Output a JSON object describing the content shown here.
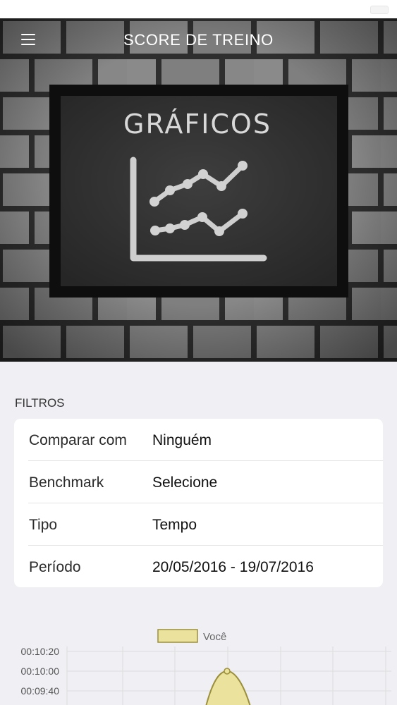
{
  "app_bar": {
    "title": "SCORE DE TREINO",
    "menu_icon": "menu-icon"
  },
  "hero": {
    "blackboard_text": "GRÁFICOS"
  },
  "filters": {
    "section_title": "FILTROS",
    "rows": [
      {
        "label": "Comparar com",
        "value": "Ninguém"
      },
      {
        "label": "Benchmark",
        "value": "Selecione"
      },
      {
        "label": "Tipo",
        "value": "Tempo"
      },
      {
        "label": "Período",
        "value": "20/05/2016 - 19/07/2016"
      }
    ]
  },
  "colors": {
    "series_fill": "#ebe29e",
    "series_stroke": "#9c8f3a",
    "card": "#ffffff",
    "background": "#efeff4"
  },
  "chart_data": {
    "type": "area",
    "title": "",
    "xlabel": "",
    "ylabel": "",
    "y_ticks": [
      "00:10:20",
      "00:10:00",
      "00:09:40"
    ],
    "legend": {
      "position": "top-center",
      "entries": [
        "Você"
      ]
    },
    "series": [
      {
        "name": "Você",
        "peak_value": "00:10:00"
      }
    ],
    "grid": true
  }
}
